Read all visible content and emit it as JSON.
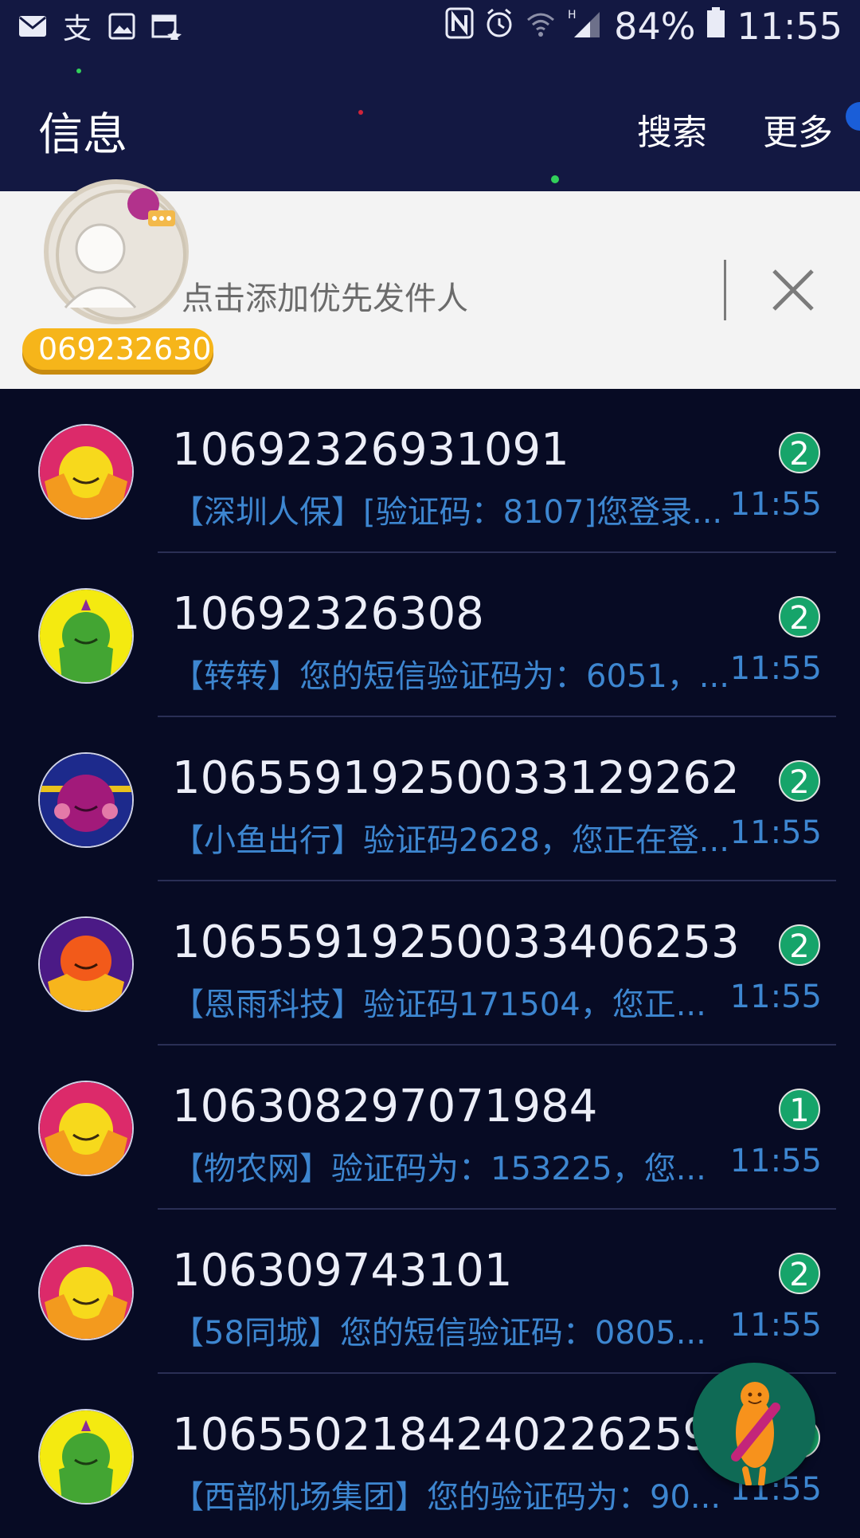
{
  "status_bar": {
    "battery": "84%",
    "time": "11:55",
    "icons_left": [
      "mail-icon",
      "alipay-icon",
      "image-icon",
      "calendar-icon"
    ],
    "icons_right": [
      "nfc-icon",
      "alarm-icon",
      "wifi-icon",
      "signal-icon",
      "battery-icon"
    ]
  },
  "app_bar": {
    "title": "信息",
    "search_label": "搜索",
    "more_label": "更多"
  },
  "priority_sender": {
    "placeholder": "点击添加优先发件人",
    "chip_text": "069232630"
  },
  "conversations": [
    {
      "sender": "10692326931091",
      "preview": "【深圳人保】[验证码：8107]您登录...",
      "time": "11:55",
      "unread": "2",
      "avatar": "pink-monster"
    },
    {
      "sender": "10692326308",
      "preview": "【转转】您的短信验证码为：6051，...",
      "time": "11:55",
      "unread": "2",
      "avatar": "green-monster"
    },
    {
      "sender": "1065591925003312926 2",
      "preview": "【小鱼出行】验证码2628，您正在登...",
      "time": "11:55",
      "unread": "2",
      "avatar": "purple-monster"
    },
    {
      "sender": "10655919250033406253",
      "preview": "【恩雨科技】验证码171504，您正...",
      "time": "11:55",
      "unread": "2",
      "avatar": "orange-monster"
    },
    {
      "sender": "106308297071984",
      "preview": "【物农网】验证码为：153225，您...",
      "time": "11:55",
      "unread": "1",
      "avatar": "pink-monster"
    },
    {
      "sender": "106309743101",
      "preview": "【58同城】您的短信验证码：0805...",
      "time": "11:55",
      "unread": "2",
      "avatar": "pink-monster"
    },
    {
      "sender": "10655021842402262592",
      "preview": "【西部机场集团】您的验证码为：90...",
      "time": "11:55",
      "unread": "2",
      "avatar": "green-monster"
    }
  ],
  "colors": {
    "header": "#131842",
    "background": "#070b24",
    "accent_blue": "#3d86d0",
    "badge_green": "#16a46a"
  }
}
